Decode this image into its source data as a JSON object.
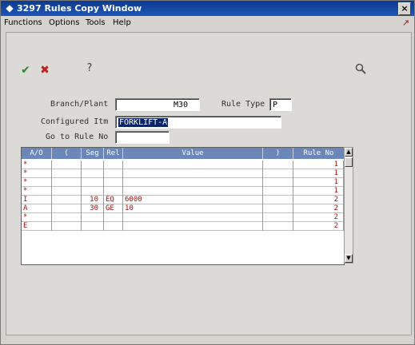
{
  "window": {
    "title": "3297  Rules Copy Window",
    "close_glyph": "×"
  },
  "menu": [
    {
      "label": "Functions"
    },
    {
      "label": "Options"
    },
    {
      "label": "Tools"
    },
    {
      "label": "Help"
    }
  ],
  "toolbar": {
    "ok_icon": "✔",
    "cancel_icon": "✖",
    "help_icon": "?",
    "search_icon": "🔍"
  },
  "form": {
    "branch_plant_label": "Branch/Plant",
    "branch_plant_value": "M30",
    "rule_type_label": "Rule Type",
    "rule_type_value": "P",
    "configured_item_label": "Configured Itm",
    "configured_item_value": "FORKLIFT-A",
    "goto_rule_label": "Go to Rule No",
    "goto_rule_value": ""
  },
  "grid": {
    "columns": [
      "A/O",
      "(",
      "Seg",
      "Rel",
      "Value",
      ")",
      "Rule No"
    ],
    "rows": [
      {
        "ao": "*",
        "paren_open": "",
        "seg": "",
        "rel": "",
        "value": "",
        "paren_close": "",
        "rule_no": "1"
      },
      {
        "ao": "*",
        "paren_open": "",
        "seg": "",
        "rel": "",
        "value": "",
        "paren_close": "",
        "rule_no": "1"
      },
      {
        "ao": "*",
        "paren_open": "",
        "seg": "",
        "rel": "",
        "value": "",
        "paren_close": "",
        "rule_no": "1"
      },
      {
        "ao": "*",
        "paren_open": "",
        "seg": "",
        "rel": "",
        "value": "",
        "paren_close": "",
        "rule_no": "1"
      },
      {
        "ao": "I",
        "paren_open": "",
        "seg": "10",
        "rel": "EQ",
        "value": "6000",
        "paren_close": "",
        "rule_no": "2"
      },
      {
        "ao": "A",
        "paren_open": "",
        "seg": "30",
        "rel": "GE",
        "value": "10",
        "paren_close": "",
        "rule_no": "2"
      },
      {
        "ao": "*",
        "paren_open": "",
        "seg": "",
        "rel": "",
        "value": "",
        "paren_close": "",
        "rule_no": "2"
      },
      {
        "ao": "E",
        "paren_open": "",
        "seg": "",
        "rel": "",
        "value": "",
        "paren_close": "",
        "rule_no": "2"
      }
    ]
  },
  "scrollbar": {
    "up": "▲",
    "down": "▼"
  }
}
